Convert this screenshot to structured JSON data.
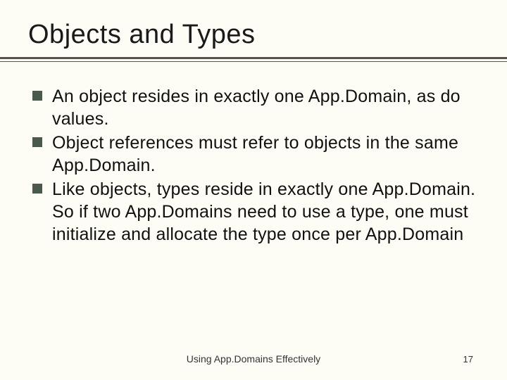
{
  "slide": {
    "title": "Objects and Types",
    "bullets": [
      "An object resides in exactly one App.Domain, as do values.",
      "Object references must refer to objects in the same App.Domain.",
      "Like objects, types reside in exactly one App.Domain. So if two App.Domains need to use a type, one must initialize and allocate the type once per App.Domain"
    ],
    "footer": "Using App.Domains Effectively",
    "page": "17"
  }
}
